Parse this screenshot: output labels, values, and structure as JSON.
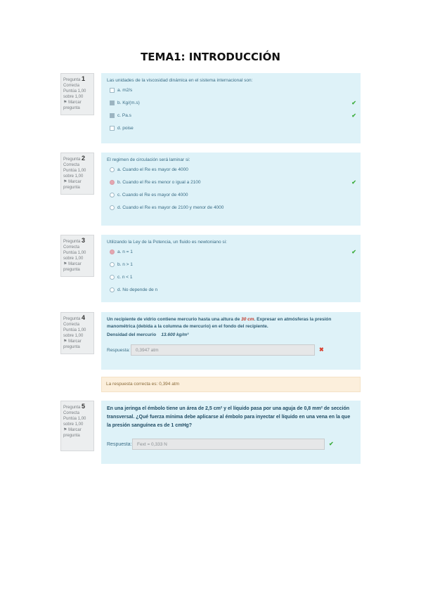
{
  "title": "TEMA1: INTRODUCCIÓN",
  "questions": [
    {
      "info": {
        "prefix": "Pregunta",
        "number": "1",
        "status": "Correcta",
        "score": "Puntúa 1,00 sobre 1,00",
        "flag": "Marcar pregunta"
      },
      "text": "Las unidades de la viscosidad dinámica en el sistema internacional son:",
      "answers": [
        "a. m2/s",
        "b. Kg/(m.s)",
        "c. Pa.s",
        "d. poise"
      ]
    },
    {
      "info": {
        "prefix": "Pregunta",
        "number": "2",
        "status": "Correcta",
        "score": "Puntúa 1,00 sobre 1,00",
        "flag": "Marcar pregunta"
      },
      "text": "El regimen de circulación será laminar si:",
      "answers": [
        "a. Cuando el Re es mayor de 4000",
        "b. Cuando el Re es menor o igual a 2100",
        "c. Cuando el Re es mayor de 4000",
        "d. Cuando el Re es mayor de 2100 y menor de 4000"
      ]
    },
    {
      "info": {
        "prefix": "Pregunta",
        "number": "3",
        "status": "Correcta",
        "score": "Puntúa 1,00 sobre 1,00",
        "flag": "Marcar pregunta"
      },
      "text": "Utilizando la Ley de la Potencia, un fluido es newtoniano si:",
      "answers": [
        "a. n = 1",
        "b. n > 1",
        "c. n < 1",
        "d. No depende de n"
      ]
    },
    {
      "info": {
        "prefix": "Pregunta",
        "number": "4",
        "status": "Correcta",
        "score": "Puntúa 1,00 sobre 1,00",
        "flag": "Marcar pregunta"
      },
      "text_parts": [
        "Un recipiente de vidrio contiene mercurio hasta una altura de ",
        "30 cm",
        ". Expresar en atmósferas la presión manométrica (debida a la columna de mercurio) en el fondo del recipiente."
      ],
      "density_label": "Densidad del mercurio",
      "density_value": "13.600 kg/m³",
      "response_label": "Respuesta:",
      "response_value": "0,3947 atm",
      "feedback": "La respuesta correcta es: 0,394 atm"
    },
    {
      "info": {
        "prefix": "Pregunta",
        "number": "5",
        "status": "Correcta",
        "score": "Puntúa 1,00 sobre 1,00",
        "flag": "Marcar pregunta"
      },
      "text": "En una jeringa el émbolo tiene un área de 2,5 cm² y el líquido pasa por una aguja de 0,8 mm² de sección transversal. ¿Qué fuerza mínima debe aplicarse al émbolo para inyectar el líquido en una vena en la que la presión sanguínea es de 1 cmHg?",
      "response_label": "Respuesta:",
      "response_value": "Fext = 0,333 N"
    }
  ],
  "icons": {
    "check": "✔",
    "cross": "✖",
    "flag": "⚑"
  }
}
